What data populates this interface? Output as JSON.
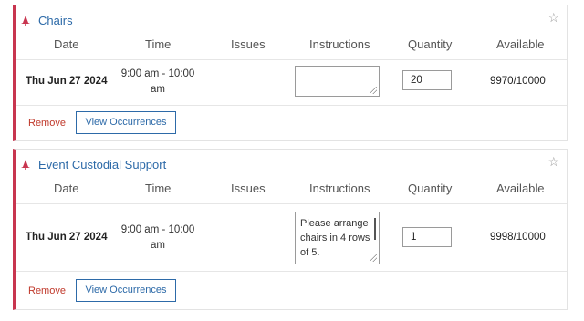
{
  "columns": [
    "Date",
    "Time",
    "Issues",
    "Instructions",
    "Quantity",
    "Available"
  ],
  "accent_color": "#c8354f",
  "link_color": "#2d6aa8",
  "items": [
    {
      "title": "Chairs",
      "date": "Thu Jun 27 2024",
      "time_line1": "9:00 am - 10:00",
      "time_line2": "am",
      "issues": "",
      "instructions": "",
      "quantity": "20",
      "available": "9970/10000",
      "remove_label": "Remove",
      "view_label": "View Occurrences"
    },
    {
      "title": "Event Custodial Support",
      "date": "Thu Jun 27 2024",
      "time_line1": "9:00 am - 10:00",
      "time_line2": "am",
      "issues": "",
      "instructions_line1": "Please arrange",
      "instructions_line2": "chairs in 4 rows",
      "instructions_line3": "of 5.",
      "quantity": "1",
      "available": "9998/10000",
      "remove_label": "Remove",
      "view_label": "View Occurrences"
    }
  ]
}
